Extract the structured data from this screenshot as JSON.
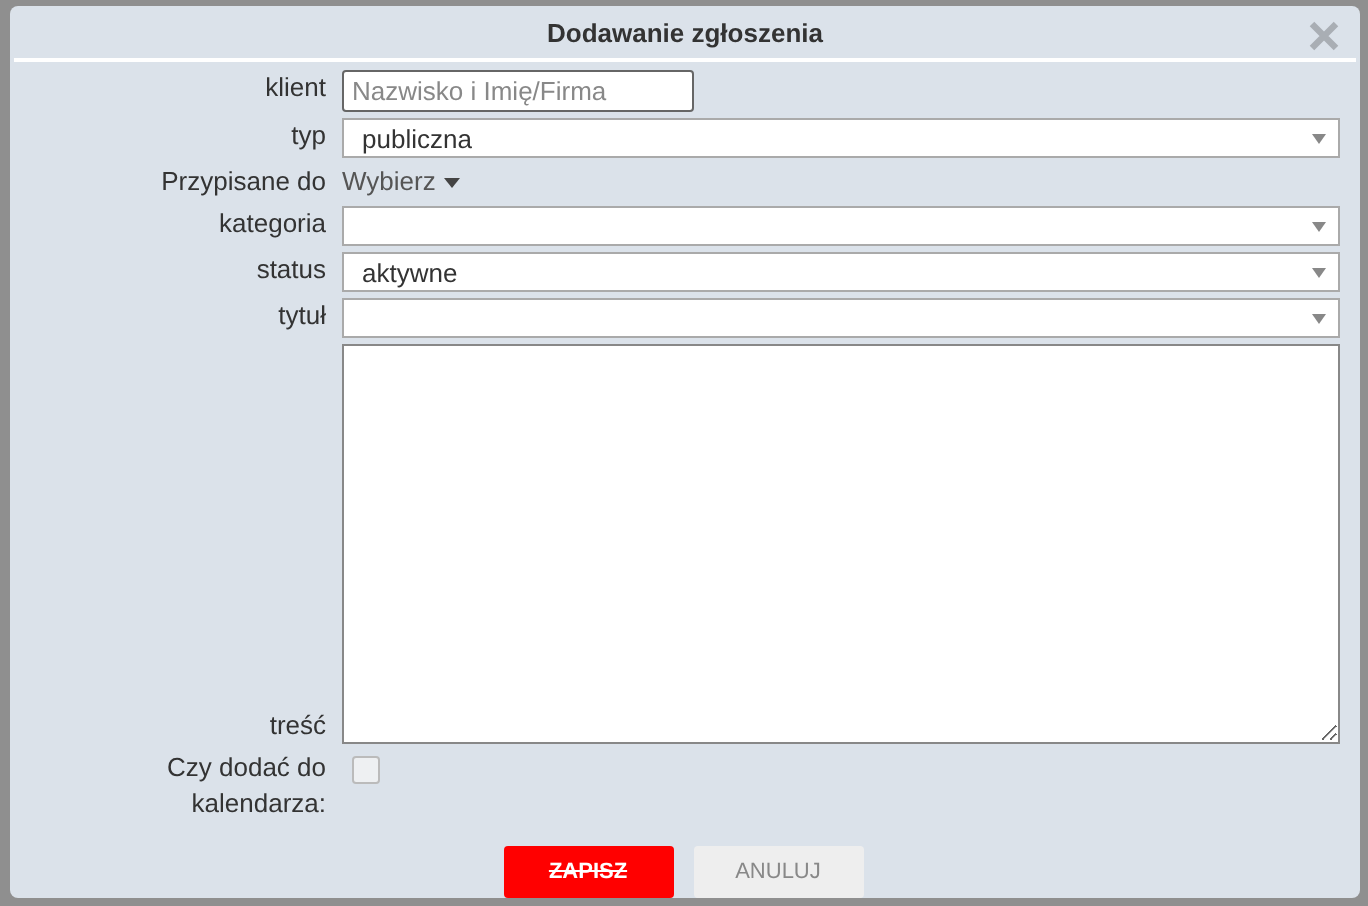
{
  "dialog": {
    "title": "Dodawanie zgłoszenia"
  },
  "fields": [
    {
      "kind": "input",
      "label": "klient",
      "placeholder": "Nazwisko i Imię/Firma"
    },
    {
      "kind": "select",
      "label": "typ",
      "value": "publiczna"
    },
    {
      "kind": "dropdown",
      "label": "Przypisane do",
      "value": "Wybierz"
    },
    {
      "kind": "select",
      "label": "kategoria"
    },
    {
      "kind": "select",
      "label": "status",
      "value": "aktywne"
    },
    {
      "kind": "select",
      "label": "tytuł"
    },
    {
      "kind": "textarea",
      "label": "treść"
    },
    {
      "kind": "checkbox",
      "label": "Czy dodać do kalendarza:",
      "checked": false
    }
  ],
  "buttons": [
    {
      "label": "ZAPISZ",
      "kind": "primary"
    },
    {
      "label": "ANULUJ",
      "kind": "secondary"
    }
  ]
}
